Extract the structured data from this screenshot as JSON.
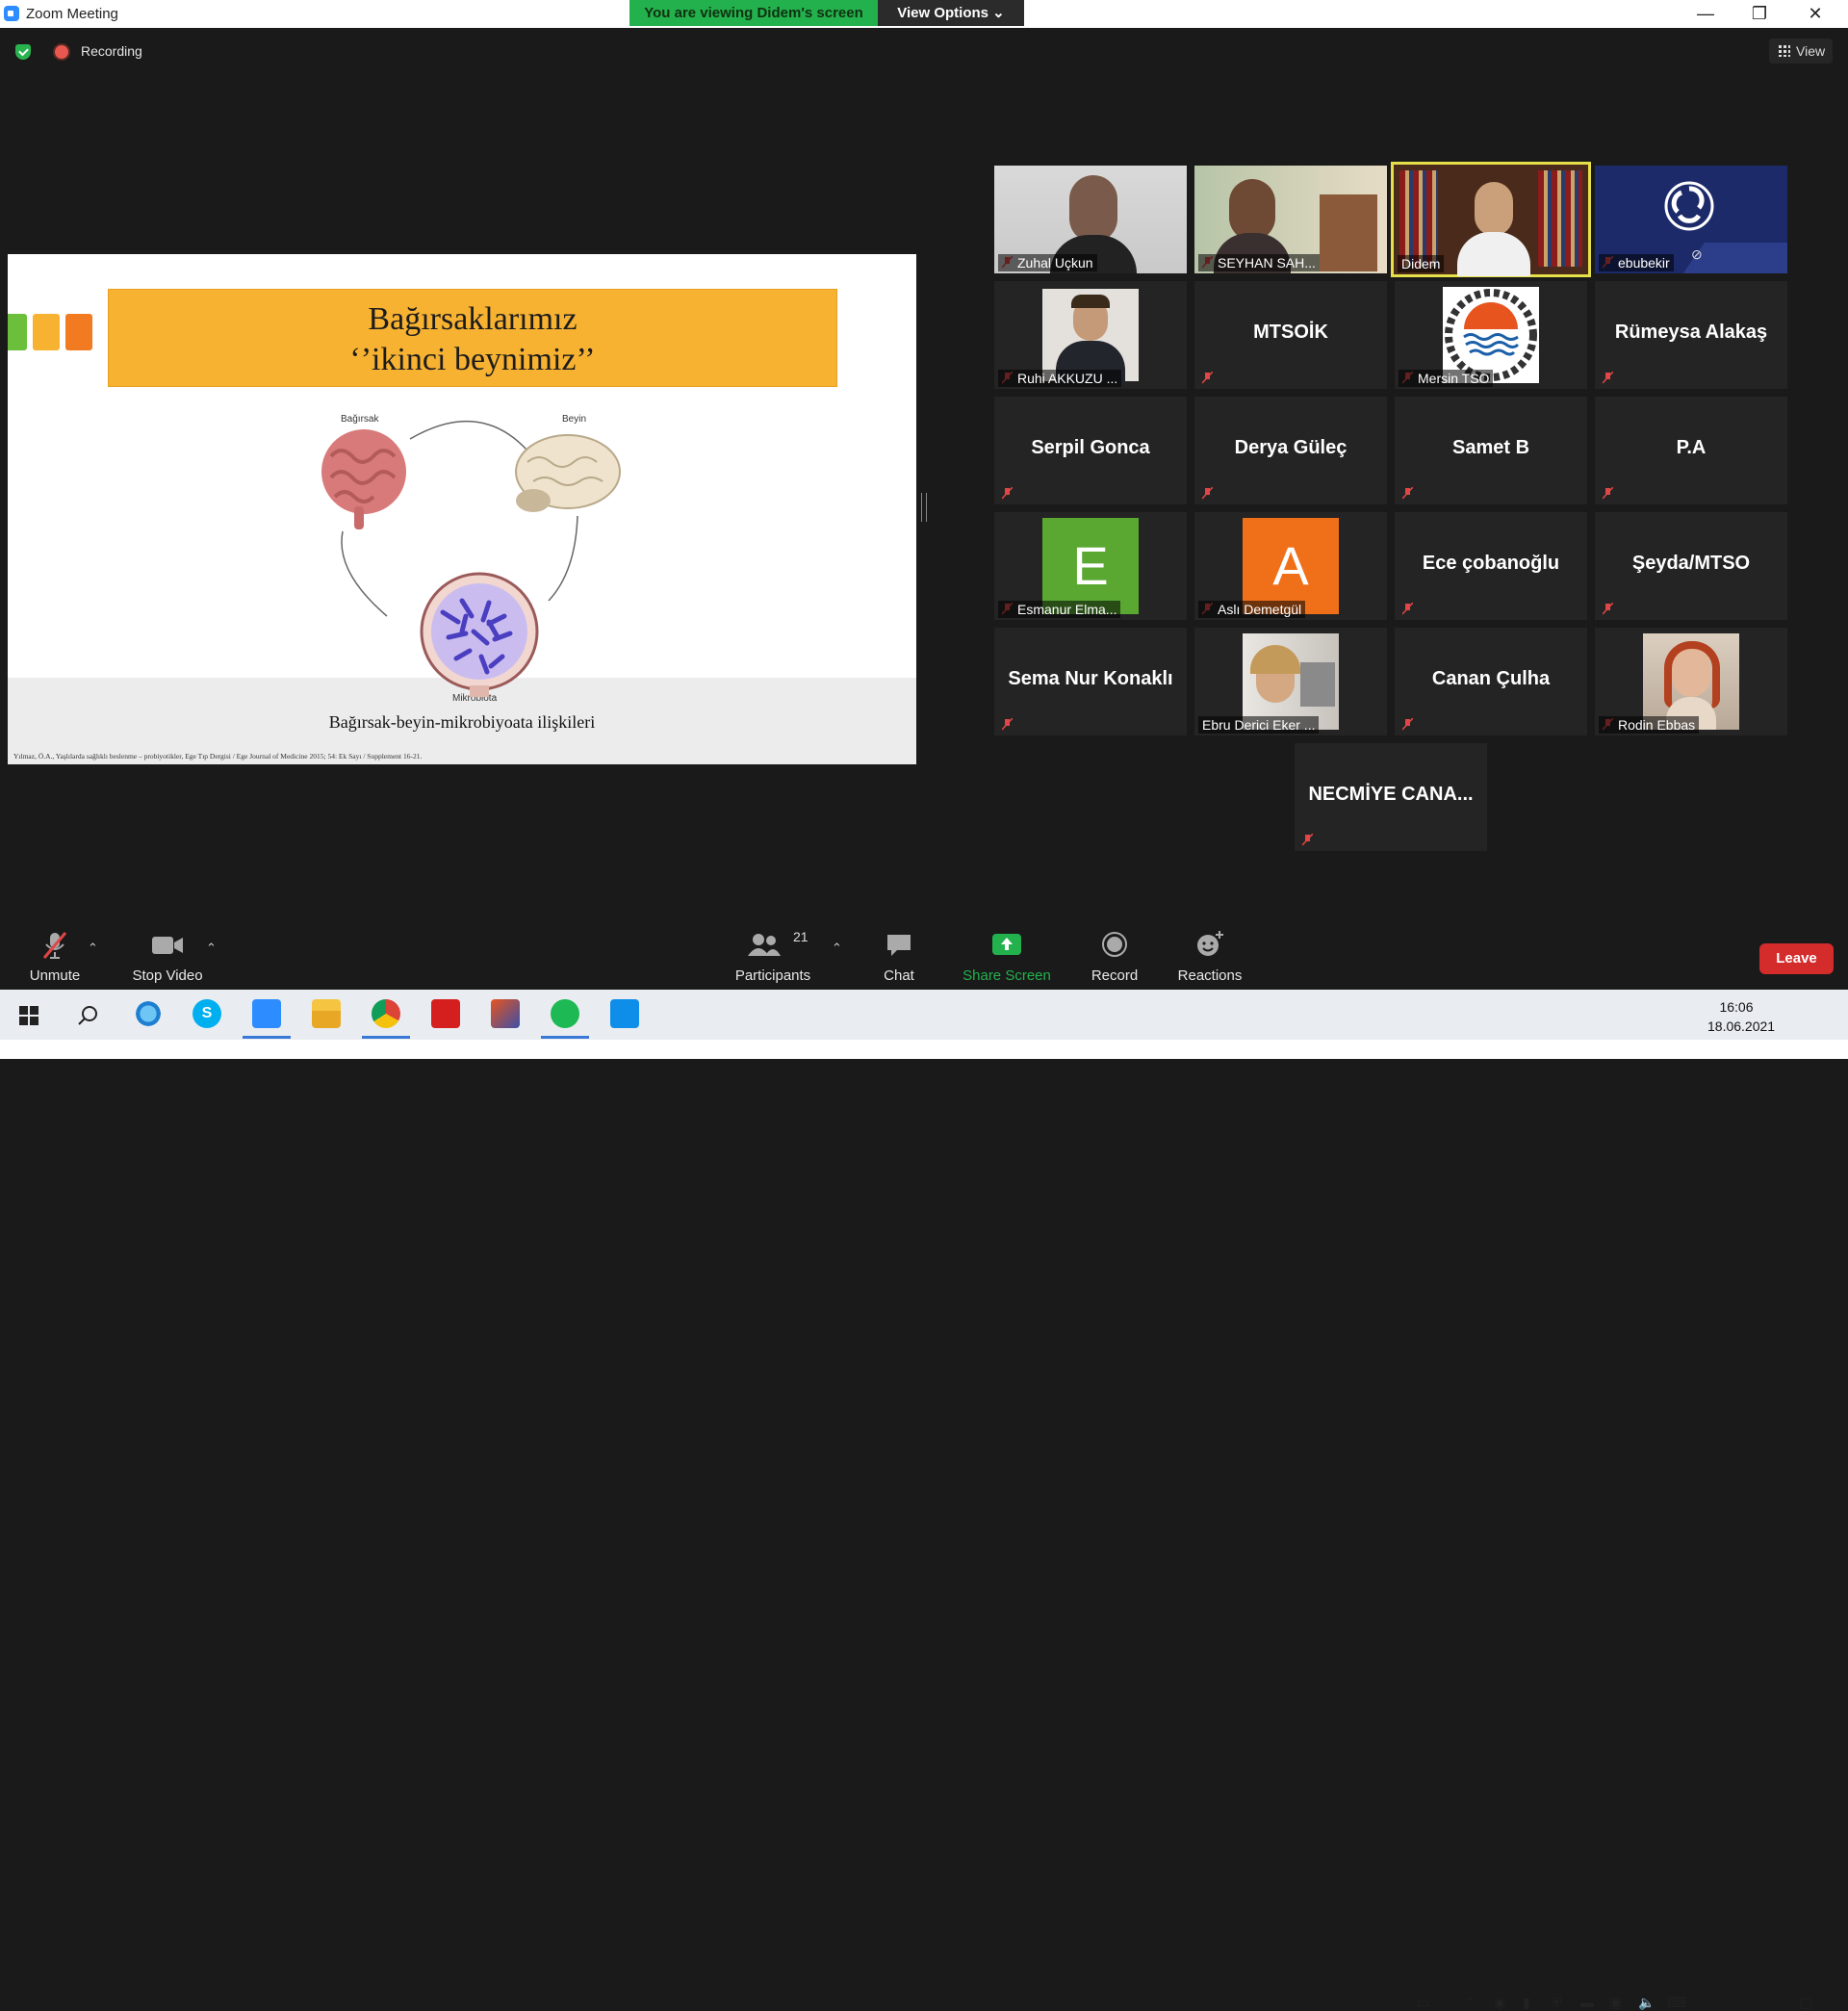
{
  "window": {
    "title": "Zoom Meeting",
    "viewing_banner": "You are viewing Didem's screen",
    "view_options": "View Options ⌄",
    "minimize": "—",
    "restore": "❐",
    "close": "✕"
  },
  "top": {
    "recording": "Recording",
    "view": "View"
  },
  "slide": {
    "title_line1": "Bağırsaklarımız",
    "title_line2": "‘’ikinci beynimiz’’",
    "label_gut": "Bağırsak",
    "label_brain": "Beyin",
    "label_micro": "Mikrobiota",
    "caption": "Bağırsak-beyin-mikrobiyoata ilişkileri",
    "footnote": "Yılmaz, Ö.A., Yaşlılarda sağlıklı beslenme – probiyotikler, Ege Tıp Dergisi / Ege Journal of Medicine 2015; 54: Ek Sayı / Supplement 16-21.",
    "accent_colors": [
      "#6cbf3a",
      "#f8b232",
      "#f27b21"
    ]
  },
  "participants": [
    {
      "name": "Zuhal Uçkun",
      "kind": "video"
    },
    {
      "name": "SEYHAN SAH...",
      "kind": "video"
    },
    {
      "name": "Didem",
      "kind": "video",
      "active": true
    },
    {
      "name": "ebubekir",
      "kind": "logo"
    },
    {
      "name": "Ruhi AKKUZU ...",
      "kind": "photo"
    },
    {
      "name": "MTSOİK",
      "kind": "text"
    },
    {
      "name": "Mersin TSO",
      "kind": "photo"
    },
    {
      "name": "Rümeysa Alakaş",
      "kind": "text"
    },
    {
      "name": "Serpil Gonca",
      "kind": "text"
    },
    {
      "name": "Derya Güleç",
      "kind": "text"
    },
    {
      "name": "Samet B",
      "kind": "text"
    },
    {
      "name": "P.A",
      "kind": "text"
    },
    {
      "name": "Esmanur Elma...",
      "kind": "letter",
      "letter": "E",
      "color": "#5aa832"
    },
    {
      "name": "Aslı Demetgül",
      "kind": "letter",
      "letter": "A",
      "color": "#f0701a"
    },
    {
      "name": "Ece çobanoğlu",
      "kind": "text"
    },
    {
      "name": "Şeyda/MTSO",
      "kind": "text"
    },
    {
      "name": "Sema Nur Konaklı",
      "kind": "text"
    },
    {
      "name": "Ebru Derici Eker ...",
      "kind": "photo"
    },
    {
      "name": "Canan Çulha",
      "kind": "text"
    },
    {
      "name": "Rodin Ebbas",
      "kind": "photo"
    },
    {
      "name": "NECMİYE  CANA...",
      "kind": "text"
    }
  ],
  "toolbar": {
    "unmute": "Unmute",
    "stop_video": "Stop Video",
    "participants": "Participants",
    "participants_count": "21",
    "chat": "Chat",
    "share_screen": "Share Screen",
    "record": "Record",
    "reactions": "Reactions",
    "leave": "Leave"
  },
  "taskbar": {
    "time": "16:06",
    "date": "18.06.2021"
  },
  "colors": {
    "banner_green": "#23b14d",
    "share_green": "#23b14d",
    "leave_red": "#d42b2b",
    "active_speaker": "#e5e04a"
  }
}
